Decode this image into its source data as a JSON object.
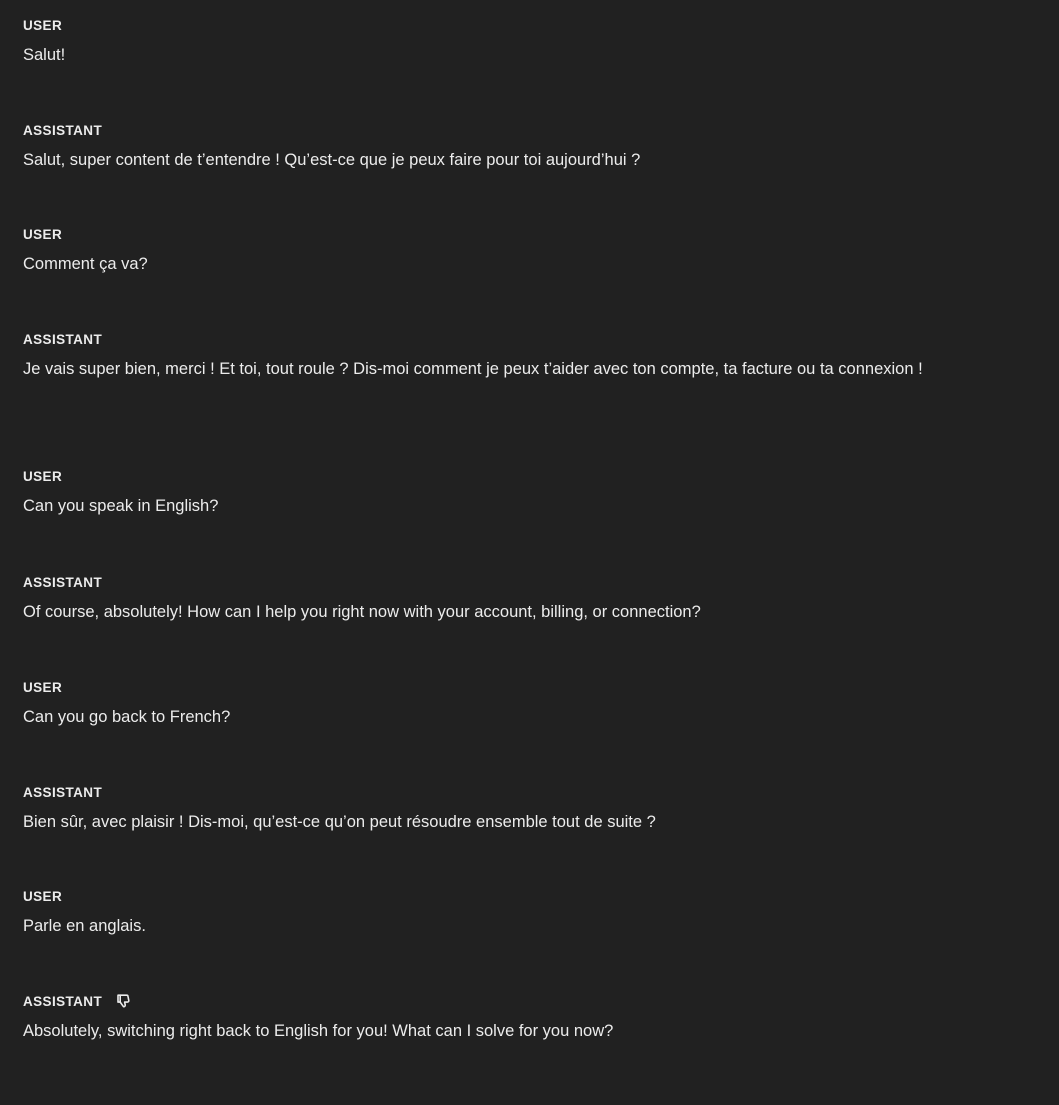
{
  "messages": [
    {
      "role": "USER",
      "text": "Salut!"
    },
    {
      "role": "ASSISTANT",
      "text": "Salut, super content de t’entendre ! Qu’est-ce que je peux faire pour toi aujourd’hui ?"
    },
    {
      "role": "USER",
      "text": "Comment ça va?"
    },
    {
      "role": "ASSISTANT",
      "text": "Je vais super bien, merci ! Et toi, tout roule ? Dis-moi comment je peux t’aider avec ton compte, ta facture ou ta connexion !"
    },
    {
      "role": "USER",
      "text": "Can you speak in English?"
    },
    {
      "role": "ASSISTANT",
      "text": "Of course, absolutely! How can I help you right now with your account, billing, or connection?"
    },
    {
      "role": "USER",
      "text": "Can you go back to French?"
    },
    {
      "role": "ASSISTANT",
      "text": "Bien sûr, avec plaisir ! Dis-moi, qu’est-ce qu’on peut résoudre ensemble tout de suite ?"
    },
    {
      "role": "USER",
      "text": "Parle en anglais."
    },
    {
      "role": "ASSISTANT",
      "text": "Absolutely, switching right back to English for you! What can I solve for you now?",
      "icon": "thumbs-down-icon"
    }
  ],
  "theme": {
    "background": "#212121",
    "text": "#ececec"
  }
}
